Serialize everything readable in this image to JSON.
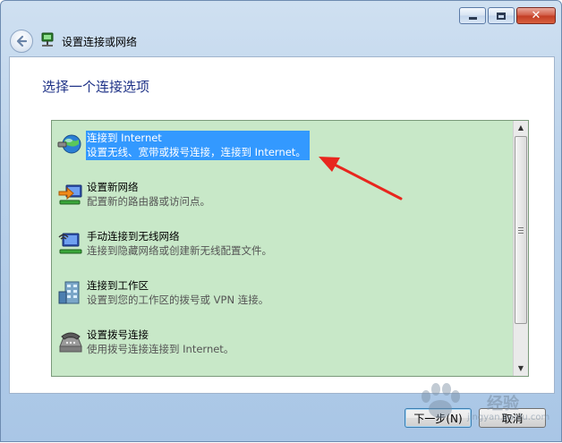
{
  "window": {
    "title": "设置连接或网络",
    "buttons": {
      "minimize": "minimize-icon",
      "maximize": "maximize-icon",
      "close": "close-icon"
    }
  },
  "page": {
    "subtitle": "选择一个连接选项"
  },
  "options": [
    {
      "title": "连接到 Internet",
      "desc": "设置无线、宽带或拨号连接，连接到 Internet。",
      "icon": "globe-network-icon",
      "selected": true
    },
    {
      "title": "设置新网络",
      "desc": "配置新的路由器或访问点。",
      "icon": "new-network-icon",
      "selected": false
    },
    {
      "title": "手动连接到无线网络",
      "desc": "连接到隐藏网络或创建新无线配置文件。",
      "icon": "wireless-network-icon",
      "selected": false
    },
    {
      "title": "连接到工作区",
      "desc": "设置到您的工作区的拨号或 VPN 连接。",
      "icon": "workplace-icon",
      "selected": false
    },
    {
      "title": "设置拨号连接",
      "desc": "使用拨号连接连接到 Internet。",
      "icon": "dialup-phone-icon",
      "selected": false
    }
  ],
  "footer": {
    "next_label": "下一步(N)",
    "cancel_label": "取消"
  },
  "watermark": {
    "text": "经验",
    "sub": "jingyan.baidu.com"
  },
  "colors": {
    "list_bg": "#c8e8c8",
    "selection": "#3399ff",
    "subtitle": "#1e3287",
    "annotation_arrow": "#e8261e"
  }
}
